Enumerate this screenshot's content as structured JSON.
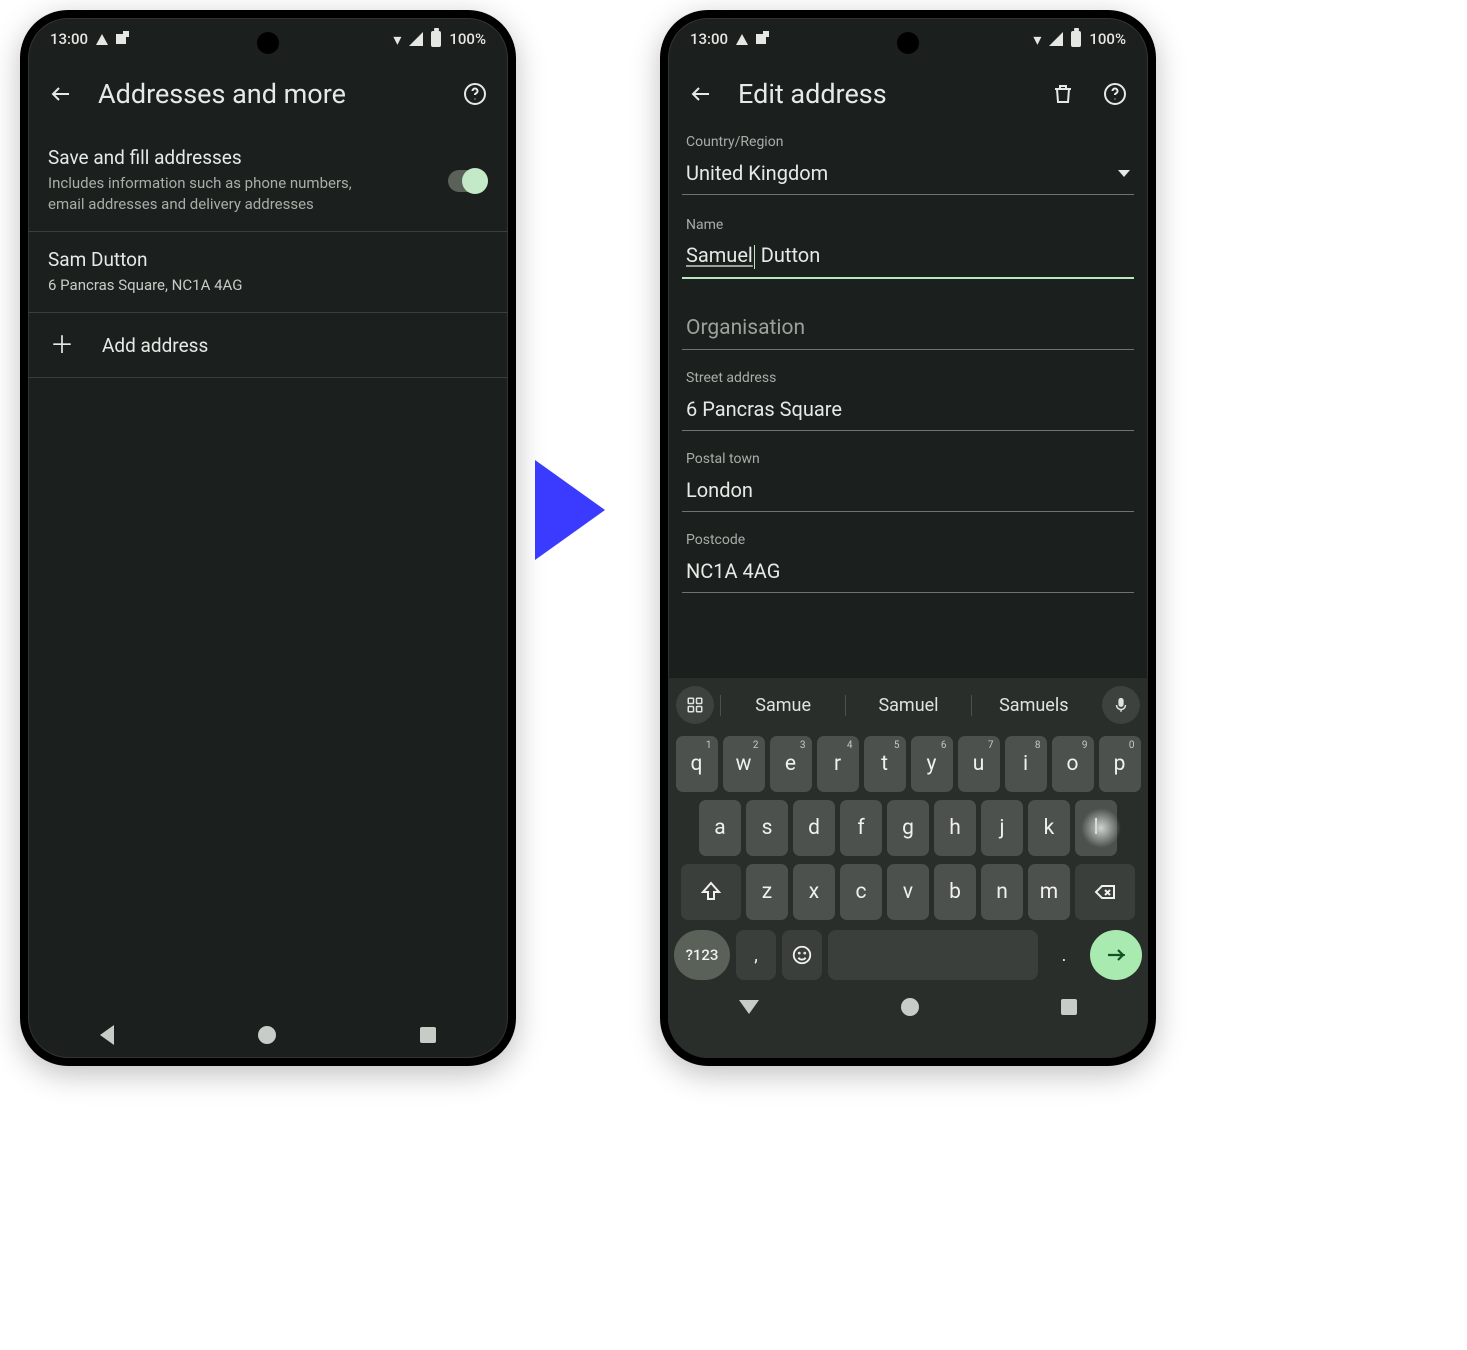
{
  "status": {
    "time": "13:00",
    "battery": "100%"
  },
  "left": {
    "title": "Addresses and more",
    "toggle": {
      "heading": "Save and fill addresses",
      "sub": "Includes information such as phone numbers, email addresses and delivery addresses"
    },
    "entry": {
      "name": "Sam Dutton",
      "addr": "6 Pancras Square, NC1A 4AG"
    },
    "add": "Add address"
  },
  "right": {
    "title": "Edit address",
    "fields": {
      "country_label": "Country/Region",
      "country_value": "United Kingdom",
      "name_label": "Name",
      "name_first": "Samuel",
      "name_last": " Dutton",
      "org_placeholder": "Organisation",
      "street_label": "Street address",
      "street_value": "6 Pancras Square",
      "town_label": "Postal town",
      "town_value": "London",
      "post_label": "Postcode",
      "post_value": "NC1A 4AG"
    }
  },
  "keyboard": {
    "suggestions": [
      "Samue",
      "Samuel",
      "Samuels"
    ],
    "row1": [
      "q",
      "w",
      "e",
      "r",
      "t",
      "y",
      "u",
      "i",
      "o",
      "p"
    ],
    "row1sup": [
      "1",
      "2",
      "3",
      "4",
      "5",
      "6",
      "7",
      "8",
      "9",
      "0"
    ],
    "row2": [
      "a",
      "s",
      "d",
      "f",
      "g",
      "h",
      "j",
      "k",
      "l"
    ],
    "row3": [
      "z",
      "x",
      "c",
      "v",
      "b",
      "n",
      "m"
    ],
    "sym": "?123",
    "comma": ",",
    "dot": "."
  }
}
